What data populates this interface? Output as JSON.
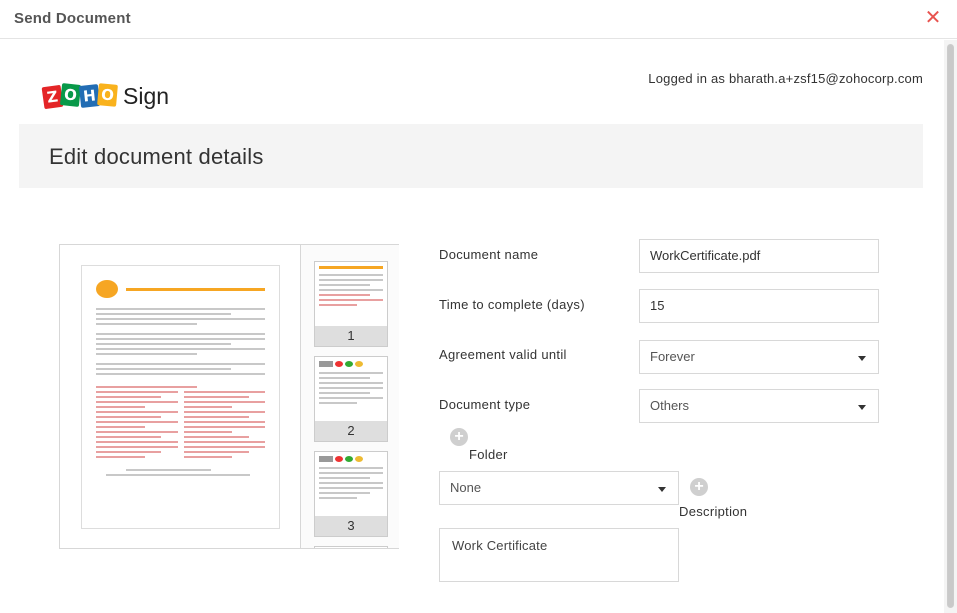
{
  "dialog": {
    "title": "Send Document",
    "close_icon": "close-icon"
  },
  "logo": {
    "letters": [
      "Z",
      "O",
      "H",
      "O"
    ],
    "product": "Sign"
  },
  "logged_in": "Logged in as bharath.a+zsf15@zohocorp.com",
  "page_header": "Edit document details",
  "preview": {
    "thumbnails": [
      {
        "page": "1"
      },
      {
        "page": "2"
      },
      {
        "page": "3"
      }
    ]
  },
  "form": {
    "document_name_label": "Document name",
    "document_name_value": "WorkCertificate.pdf",
    "time_label": "Time to complete (days)",
    "time_value": "15",
    "validity_label": "Agreement valid until",
    "validity_value": "Forever",
    "doctype_label": "Document type",
    "doctype_value": "Others",
    "folder_label": "Folder",
    "folder_value": "None",
    "description_label": "Description",
    "description_value": "Work Certificate"
  },
  "colors": {
    "close": "#e8534f",
    "header_band": "#f4f4f4"
  }
}
